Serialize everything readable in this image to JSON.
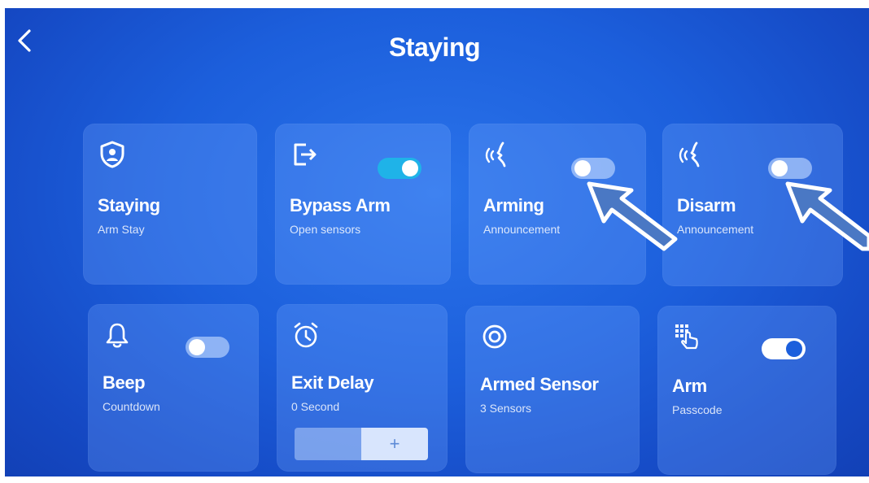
{
  "header": {
    "title": "Staying"
  },
  "cards": [
    {
      "label": "Staying",
      "sub": "Arm Stay",
      "icon": "shield-user-icon"
    },
    {
      "label": "Bypass Arm",
      "sub": "Open sensors",
      "icon": "exit-arrow-icon",
      "toggle": "on"
    },
    {
      "label": "Arming",
      "sub": "Announcement",
      "icon": "voice-announcement-icon",
      "toggle": "off"
    },
    {
      "label": "Disarm",
      "sub": "Announcement",
      "icon": "voice-announcement-icon",
      "toggle": "off"
    },
    {
      "label": "Beep",
      "sub": "Countdown",
      "icon": "bell-icon",
      "toggle": "off"
    },
    {
      "label": "Exit Delay",
      "sub": "0 Second",
      "icon": "alarm-clock-icon",
      "stepper_plus": "+"
    },
    {
      "label": "Armed Sensor",
      "sub": "3 Sensors",
      "icon": "target-sensor-icon"
    },
    {
      "label": "Arm",
      "sub": "Passcode",
      "icon": "keypad-hand-icon",
      "toggle": "on"
    }
  ],
  "colors": {
    "background": "#1c5fdc",
    "toggle_on": "#1fb3e8",
    "annotation_arrow": "#4a78c4"
  }
}
